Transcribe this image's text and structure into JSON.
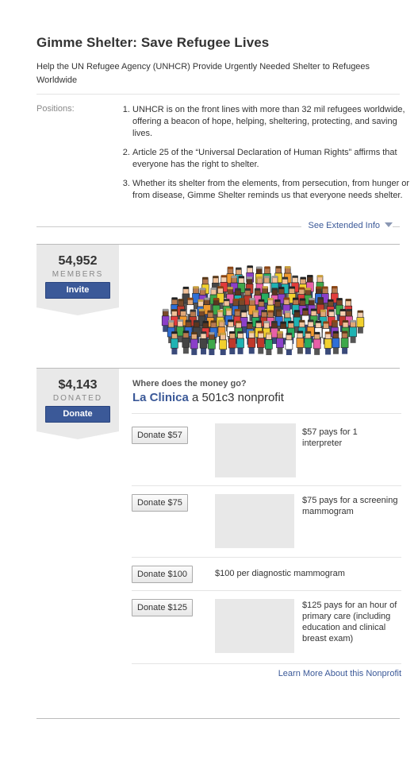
{
  "header": {
    "title": "Gimme Shelter: Save Refugee Lives",
    "subtitle": "Help the UN Refugee Agency (UNHCR) Provide Urgently Needed Shelter to Refugees Worldwide"
  },
  "positions": {
    "label": "Positions:",
    "items": [
      "UNHCR is on the front lines with more than 32 mil refugees worldwide, offering a beacon of hope, helping, sheltering, protecting, and saving lives.",
      "Article 25 of the “Universal Declaration of Human Rights” affirms that everyone has the right to shelter.",
      "Whether its shelter from the elements, from persecution, from hunger or from disease, Gimme Shelter reminds us that everyone needs shelter."
    ],
    "extended_link": "See Extended Info"
  },
  "members": {
    "count": "54,952",
    "label": "MEMBERS",
    "button": "Invite"
  },
  "donated": {
    "amount": "$4,143",
    "label": "DONATED",
    "button": "Donate"
  },
  "donation": {
    "question": "Where does the money go?",
    "org_name": "La Clinica",
    "org_desc": "a 501c3 nonprofit",
    "options": [
      {
        "button": "Donate $57",
        "text": "$57 pays for 1 interpreter"
      },
      {
        "button": "Donate $75",
        "text": "$75 pays for a screening mammogram"
      },
      {
        "button": "Donate $100",
        "text": "$100 per diagnostic mammogram"
      },
      {
        "button": "Donate $125",
        "text": "$125 pays for an hour of primary care (including education and clinical breast exam)"
      }
    ],
    "learn_more": "Learn More About this Nonprofit"
  },
  "colors": {
    "link": "#3b5998",
    "button_bg": "#3b5998",
    "badge_bg": "#e9e9e9"
  }
}
